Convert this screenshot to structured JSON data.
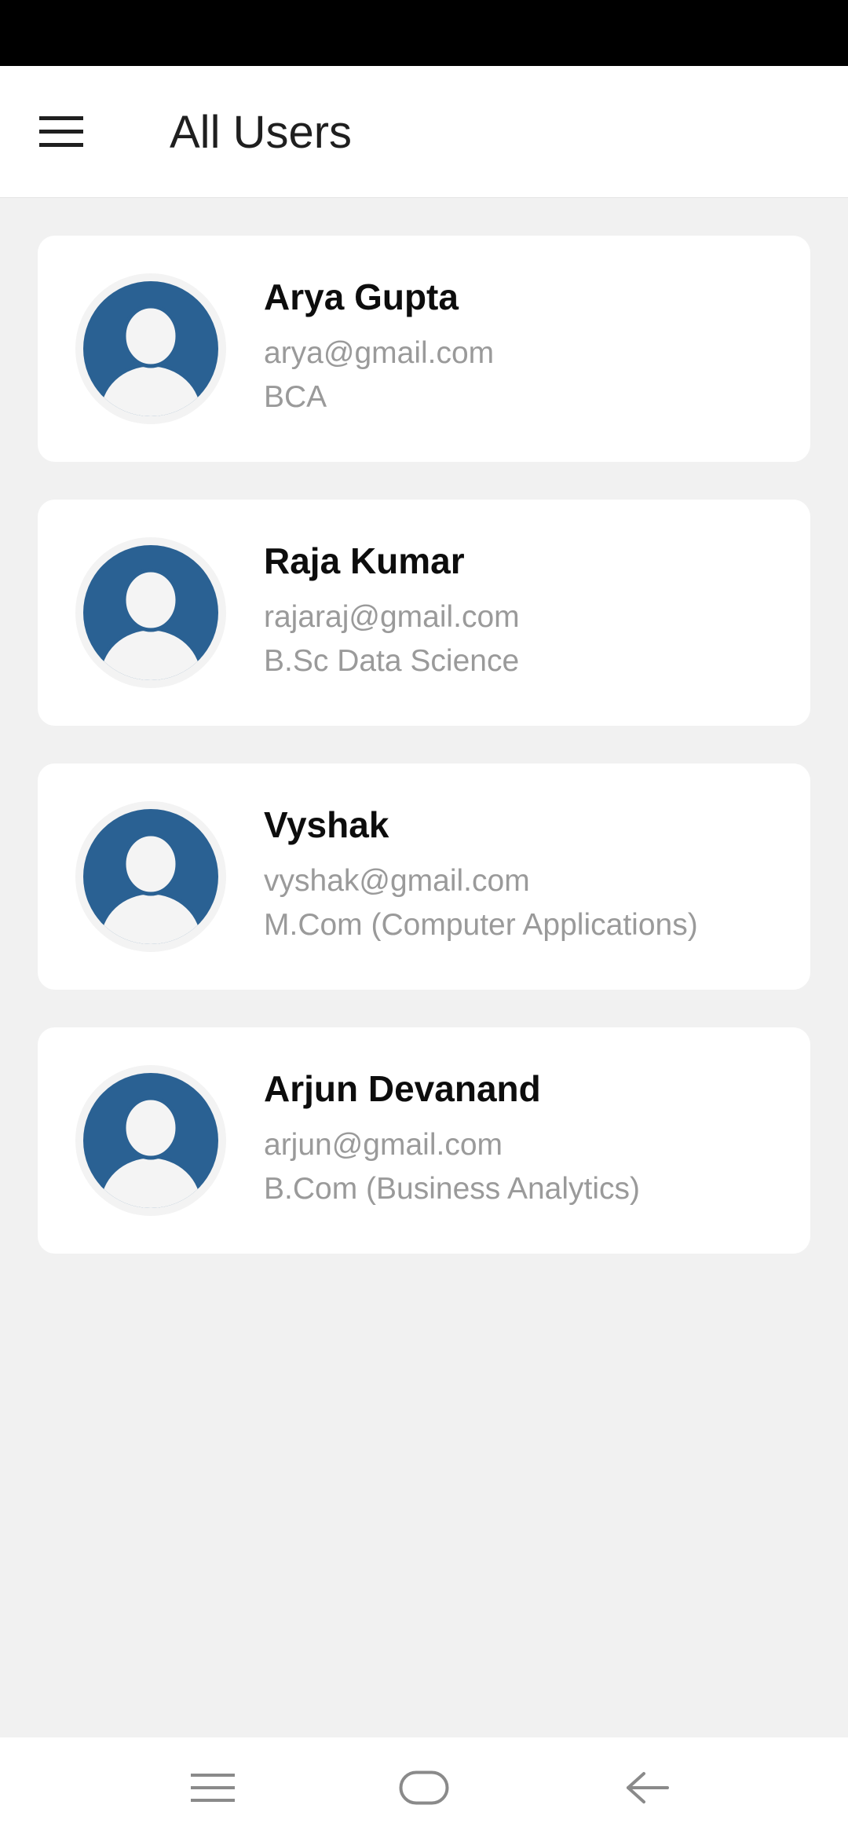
{
  "app_bar": {
    "title": "All Users",
    "menu_icon": "hamburger-menu-icon"
  },
  "users": [
    {
      "name": "Arya Gupta",
      "email": "arya@gmail.com",
      "course": "BCA",
      "avatar_icon": "user-avatar-icon"
    },
    {
      "name": "Raja Kumar",
      "email": "rajaraj@gmail.com",
      "course": "B.Sc Data Science",
      "avatar_icon": "user-avatar-icon"
    },
    {
      "name": "Vyshak",
      "email": "vyshak@gmail.com",
      "course": "M.Com (Computer Applications)",
      "avatar_icon": "user-avatar-icon"
    },
    {
      "name": "Arjun Devanand",
      "email": "arjun@gmail.com",
      "course": "B.Com (Business Analytics)",
      "avatar_icon": "user-avatar-icon"
    }
  ],
  "nav_bar": {
    "recents_icon": "recents-icon",
    "home_icon": "home-icon",
    "back_icon": "back-arrow-icon"
  },
  "colors": {
    "avatar_blue": "#2a6193",
    "background": "#f1f1f1",
    "card": "#ffffff",
    "secondary_text": "#9a9a9a"
  }
}
